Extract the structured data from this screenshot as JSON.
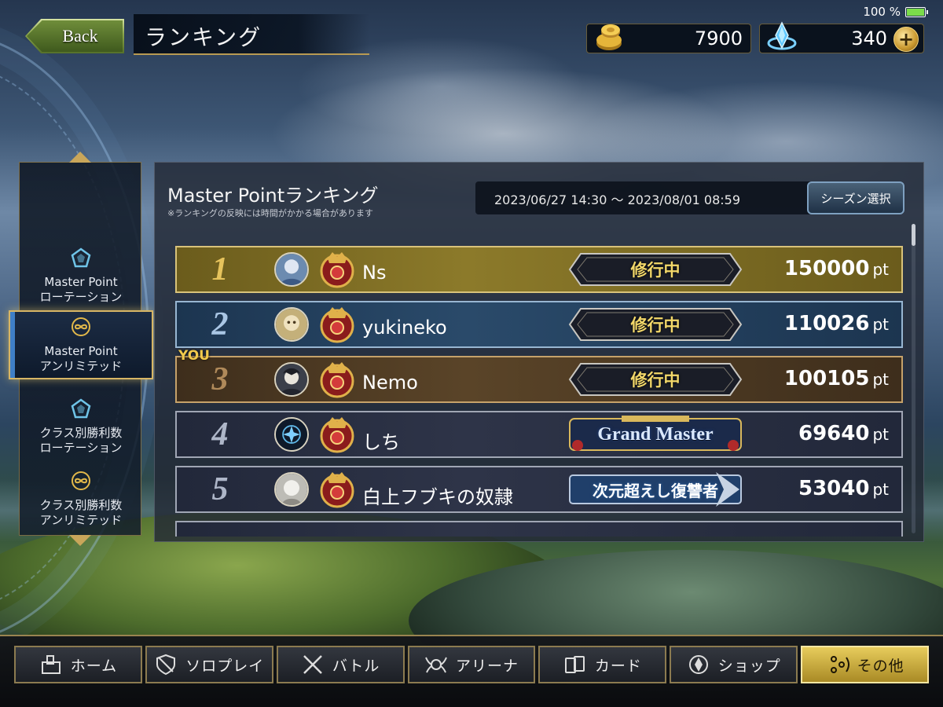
{
  "status": {
    "battery_text": "100 %",
    "battery_level": 1.0
  },
  "header": {
    "back_label": "Back",
    "title": "ランキング"
  },
  "currency": {
    "gold": {
      "icon": "gold-coins-icon",
      "amount": "7900"
    },
    "crystal": {
      "icon": "crystal-icon",
      "amount": "340",
      "plus_label": "+"
    }
  },
  "sidebar": {
    "items": [
      {
        "label_line1": "Master Point",
        "label_line2": "ローテーション",
        "icon": "rotation-pentagon-icon",
        "active": false
      },
      {
        "label_line1": "Master Point",
        "label_line2": "アンリミテッド",
        "icon": "unlimited-infinity-icon",
        "active": true
      },
      {
        "label_line1": "クラス別勝利数",
        "label_line2": "ローテーション",
        "icon": "rotation-pentagon-icon",
        "active": false
      },
      {
        "label_line1": "クラス別勝利数",
        "label_line2": "アンリミテッド",
        "icon": "unlimited-infinity-icon",
        "active": false
      }
    ]
  },
  "ranking": {
    "title": "Master Pointランキング",
    "note": "※ランキングの反映には時間がかかる場合があります",
    "period": "2023/06/27 14:30 ～ 2023/08/01 08:59",
    "season_button": "シーズン選択",
    "you_label": "YOU",
    "unit": "pt",
    "rows": [
      {
        "rank": "1",
        "name": "Ns",
        "badge": "修行中",
        "badge_type": "training",
        "points": "150000"
      },
      {
        "rank": "2",
        "name": "yukineko",
        "badge": "修行中",
        "badge_type": "training",
        "points": "110026"
      },
      {
        "rank": "3",
        "name": "Nemo",
        "badge": "修行中",
        "badge_type": "training",
        "points": "100105",
        "is_you": true
      },
      {
        "rank": "4",
        "name": "しち",
        "badge": "Grand Master",
        "badge_type": "gm",
        "points": "69640"
      },
      {
        "rank": "5",
        "name": "白上フブキの奴隷",
        "badge": "次元超えし復讐者",
        "badge_type": "avenger",
        "points": "53040"
      }
    ]
  },
  "bottom_nav": [
    {
      "label": "ホーム",
      "icon": "home-icon",
      "active": false
    },
    {
      "label": "ソロプレイ",
      "icon": "solo-shield-icon",
      "active": false
    },
    {
      "label": "バトル",
      "icon": "crossed-swords-icon",
      "active": false
    },
    {
      "label": "アリーナ",
      "icon": "arena-wings-icon",
      "active": false
    },
    {
      "label": "カード",
      "icon": "cards-icon",
      "active": false
    },
    {
      "label": "ショップ",
      "icon": "shop-crystal-icon",
      "active": false
    },
    {
      "label": "その他",
      "icon": "other-gears-icon",
      "active": true
    }
  ],
  "colors": {
    "gold_accent": "#d8b665",
    "active_nav": "#e7cc5c",
    "rank1_bg": "#8c7a2a",
    "rank2_bg": "#2a4a6a",
    "rank3_bg": "#5a4428"
  }
}
